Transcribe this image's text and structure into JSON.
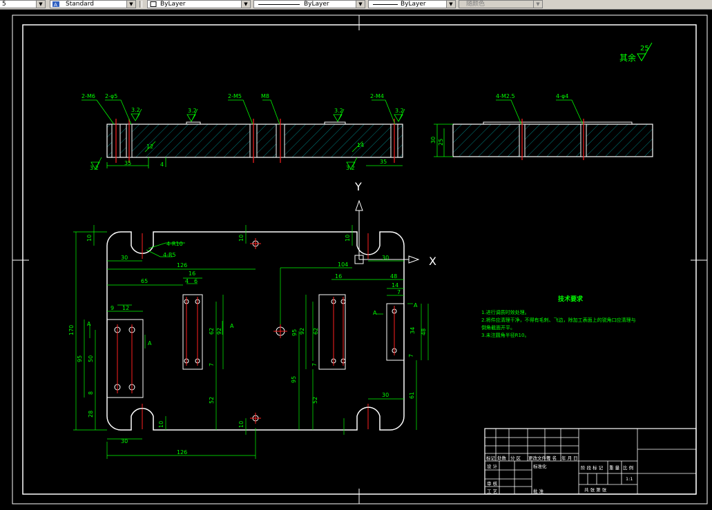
{
  "toolbar": {
    "left_stub": "5",
    "text_style": "Standard",
    "layer": "ByLayer",
    "linetype": "ByLayer",
    "lineweight": "ByLayer",
    "plot_style": "随颜色"
  },
  "drawing": {
    "roughness_note_label": "其余",
    "roughness_note_value": "25",
    "axis_x": "X",
    "axis_y": "Y",
    "section_labels": [
      "2-M6",
      "2-φ5",
      "3.2",
      "3.2",
      "2-M5",
      "M8",
      "3.2",
      "2-M4",
      "3.2",
      "3.2",
      "3.2",
      "35",
      "4",
      "35",
      "12",
      "14"
    ],
    "side_labels": [
      "4-M2.5",
      "4-φ4",
      "30",
      "25"
    ],
    "dims": [
      "10",
      "10",
      "10",
      "30",
      "126",
      "65",
      "16",
      "4",
      "6",
      "104",
      "16",
      "48",
      "14",
      "7",
      "30",
      "9",
      "12",
      "170",
      "95",
      "50",
      "8",
      "28",
      "A",
      "A",
      "62",
      "92",
      "7",
      "A",
      "95",
      "92",
      "95",
      "62",
      "7",
      "34",
      "48",
      "7",
      "A",
      "A",
      "52",
      "52",
      "30",
      "61",
      "10",
      "10",
      "30",
      "126",
      "4-R10",
      "4-R5"
    ],
    "tech_title": "技术要求",
    "tech_notes": [
      "1.进行调质时效处理。",
      "2.将件应清理干净，不得有毛刺、飞边，除加工表面上的锐角口应清理与",
      "   倒角截面开平。",
      "3.未注圆角半径R10。"
    ],
    "title_block": {
      "r1": [
        "标记",
        "处数",
        "分 区",
        "更改文件号",
        "签 名",
        "年 月 日"
      ],
      "design": "设 计",
      "std": "标准化",
      "review": "审 核",
      "process": "工 艺",
      "approve": "批 准",
      "stage": "阶 段 标 记",
      "weight": "重 量",
      "scale_label": "比 例",
      "scale": "1:1",
      "sheets": "共    张   第    张"
    }
  }
}
